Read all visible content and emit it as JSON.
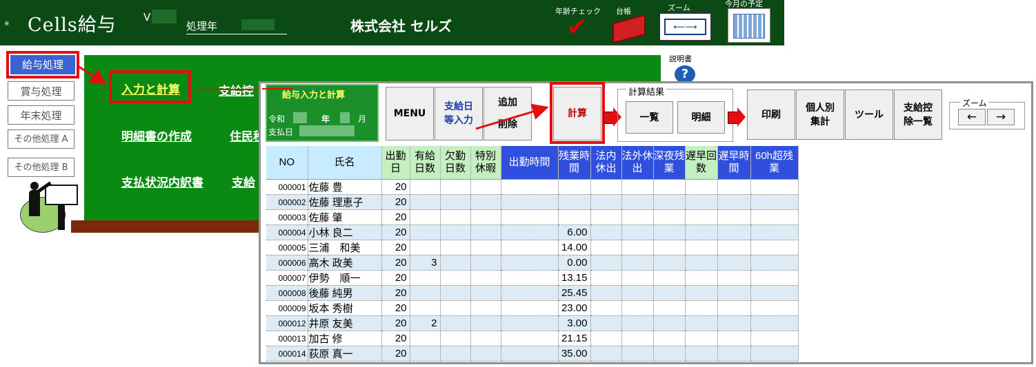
{
  "header": {
    "app_title": "Cells給与",
    "version_prefix": "V",
    "year_label": "処理年",
    "company": "株式会社 セルズ",
    "dot": "※",
    "tools": {
      "age_check": "年齢チェック",
      "ledger": "台帳",
      "zoom": "ズーム",
      "zoom_inner": "⟵⟶",
      "plan": "今月の予定"
    }
  },
  "side_menu": {
    "kyuyo": "給与処理",
    "shoyo": "賞与処理",
    "nenmatsu": "年末処理",
    "other_a": "その他処理 A",
    "other_b": "その他処理 B"
  },
  "board": {
    "nyuryoku": "入力と計算",
    "shikyu": "支給控",
    "meisai": "明細書の作成",
    "jumin": "住民税",
    "shiharai": "支払状況内訳書",
    "shiharai2": "支給"
  },
  "help": {
    "label": "説明書",
    "icon": "?"
  },
  "panel": {
    "title": "給与入力と計算",
    "reiwa": "令和",
    "nen": "年",
    "tsuki": "月",
    "payday": "支払日"
  },
  "toolbar": {
    "menu": "MENU",
    "payday_input_1": "支給日",
    "payday_input_2": "等入力",
    "add_1": "追加",
    "add_2": "削除",
    "calc": "計算",
    "calc_result": "計算結果",
    "ichiran": "一覧",
    "meisai": "明細",
    "print": "印刷",
    "personal_1": "個人別",
    "personal_2": "集計",
    "tool": "ツール",
    "deduct_1": "支給控",
    "deduct_2": "除一覧",
    "zoom": "ズーム",
    "left": "←",
    "right": "→"
  },
  "grid": {
    "headers": [
      "NO",
      "氏名",
      "出勤日",
      "有給日数",
      "欠勤日数",
      "特別休暇",
      "出勤時間",
      "残業時間",
      "法内休出",
      "法外休出",
      "深夜残業",
      "遅早回数",
      "遅早時間",
      "60h超残業"
    ],
    "rows": [
      {
        "no": "000001",
        "name": "佐藤 豊",
        "days": "20",
        "paid": "",
        "ot": ""
      },
      {
        "no": "000002",
        "name": "佐藤 理恵子",
        "days": "20",
        "paid": "",
        "ot": ""
      },
      {
        "no": "000003",
        "name": "佐藤 肇",
        "days": "20",
        "paid": "",
        "ot": ""
      },
      {
        "no": "000004",
        "name": "小林 良二",
        "days": "20",
        "paid": "",
        "ot": "6.00"
      },
      {
        "no": "000005",
        "name": "三浦　和美",
        "days": "20",
        "paid": "",
        "ot": "14.00"
      },
      {
        "no": "000006",
        "name": "高木 政美",
        "days": "20",
        "paid": "3",
        "ot": "0.00"
      },
      {
        "no": "000007",
        "name": "伊勢　順一",
        "days": "20",
        "paid": "",
        "ot": "13.15"
      },
      {
        "no": "000008",
        "name": "後藤 純男",
        "days": "20",
        "paid": "",
        "ot": "25.45"
      },
      {
        "no": "000009",
        "name": "坂本 秀樹",
        "days": "20",
        "paid": "",
        "ot": "23.00"
      },
      {
        "no": "000012",
        "name": "井原 友美",
        "days": "20",
        "paid": "2",
        "ot": "3.00"
      },
      {
        "no": "000013",
        "name": "加古 修",
        "days": "20",
        "paid": "",
        "ot": "21.15"
      },
      {
        "no": "000014",
        "name": "荻原 真一",
        "days": "20",
        "paid": "",
        "ot": "35.00"
      }
    ]
  },
  "colors": {
    "header_bg": "#0b4a15",
    "board_bg": "#0a8a12",
    "highlight": "#e01010",
    "blue_header": "#2f4fdc",
    "green_header": "#c6efc1",
    "cyan_header": "#c8ecff"
  }
}
